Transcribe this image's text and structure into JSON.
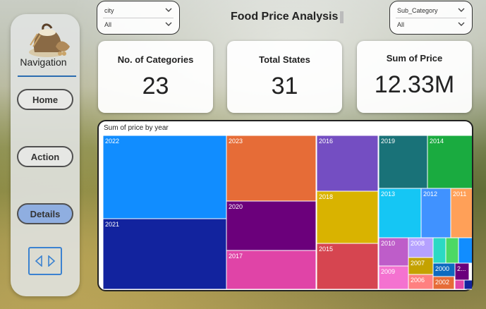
{
  "navigation": {
    "title": "Navigation",
    "buttons": [
      {
        "label": "Home",
        "active": false
      },
      {
        "label": "Action",
        "active": false
      },
      {
        "label": "Details",
        "active": true
      }
    ],
    "accent_color": "#2b6cb0",
    "logo_icon": "grain-sack-icon",
    "arrows_icon": "prev-next-arrows-icon"
  },
  "slicers": {
    "city": {
      "label": "city",
      "value": "All"
    },
    "sub_category": {
      "label": "Sub_Category",
      "value": "All"
    }
  },
  "page_title": "Food Price Analysis",
  "cards": {
    "categories": {
      "title": "No. of Categories",
      "value": "23"
    },
    "states": {
      "title": "Total States",
      "value": "31"
    },
    "price": {
      "title": "Sum of Price",
      "value": "12.33M"
    }
  },
  "chart_data": {
    "type": "treemap",
    "title": "Sum of price by year",
    "items": [
      {
        "label": "2022",
        "value": 1.4,
        "color": "#118DFF"
      },
      {
        "label": "2021",
        "value": 1.29,
        "color": "#12239E"
      },
      {
        "label": "2023",
        "value": 1.02,
        "color": "#E66C37"
      },
      {
        "label": "2020",
        "value": 0.82,
        "color": "#6B007B"
      },
      {
        "label": "2017",
        "value": 0.63,
        "color": "#E044A7"
      },
      {
        "label": "2016",
        "value": 0.7,
        "color": "#744EC2"
      },
      {
        "label": "2018",
        "value": 0.62,
        "color": "#D9B300"
      },
      {
        "label": "2015",
        "value": 0.58,
        "color": "#D64550"
      },
      {
        "label": "2019",
        "value": 0.41,
        "color": "#197278"
      },
      {
        "label": "2014",
        "value": 0.41,
        "color": "#1AAB40"
      },
      {
        "label": "2013",
        "value": 0.4,
        "color": "#15C6F4"
      },
      {
        "label": "2012",
        "value": 0.25,
        "color": "#4092FF"
      },
      {
        "label": "2011",
        "value": 0.17,
        "color": "#FFA058"
      },
      {
        "label": "2010",
        "value": 0.14,
        "color": "#BE5DC9"
      },
      {
        "label": "2009",
        "value": 0.12,
        "color": "#F472D0"
      },
      {
        "label": "2008",
        "value": 0.08,
        "color": "#B5A1FF"
      },
      {
        "label": "2007",
        "value": 0.07,
        "color": "#C4A200"
      },
      {
        "label": "2006",
        "value": 0.06,
        "color": "#FF8080"
      },
      {
        "label": "2000",
        "value": 0.05,
        "color": "#0D6ABF"
      },
      {
        "label": "2002",
        "value": 0.04,
        "color": "#E66C37"
      },
      {
        "label": "2...",
        "value": 0.03,
        "color": "#6B007B"
      },
      {
        "label": "",
        "value": 0.06,
        "color": "#2BD9C4"
      },
      {
        "label": "",
        "value": 0.05,
        "color": "#4CD964"
      },
      {
        "label": "",
        "value": 0.04,
        "color": "#118DFF"
      },
      {
        "label": "",
        "value": 0.02,
        "color": "#E044A7"
      },
      {
        "label": "",
        "value": 0.01,
        "color": "#12239E"
      }
    ]
  }
}
